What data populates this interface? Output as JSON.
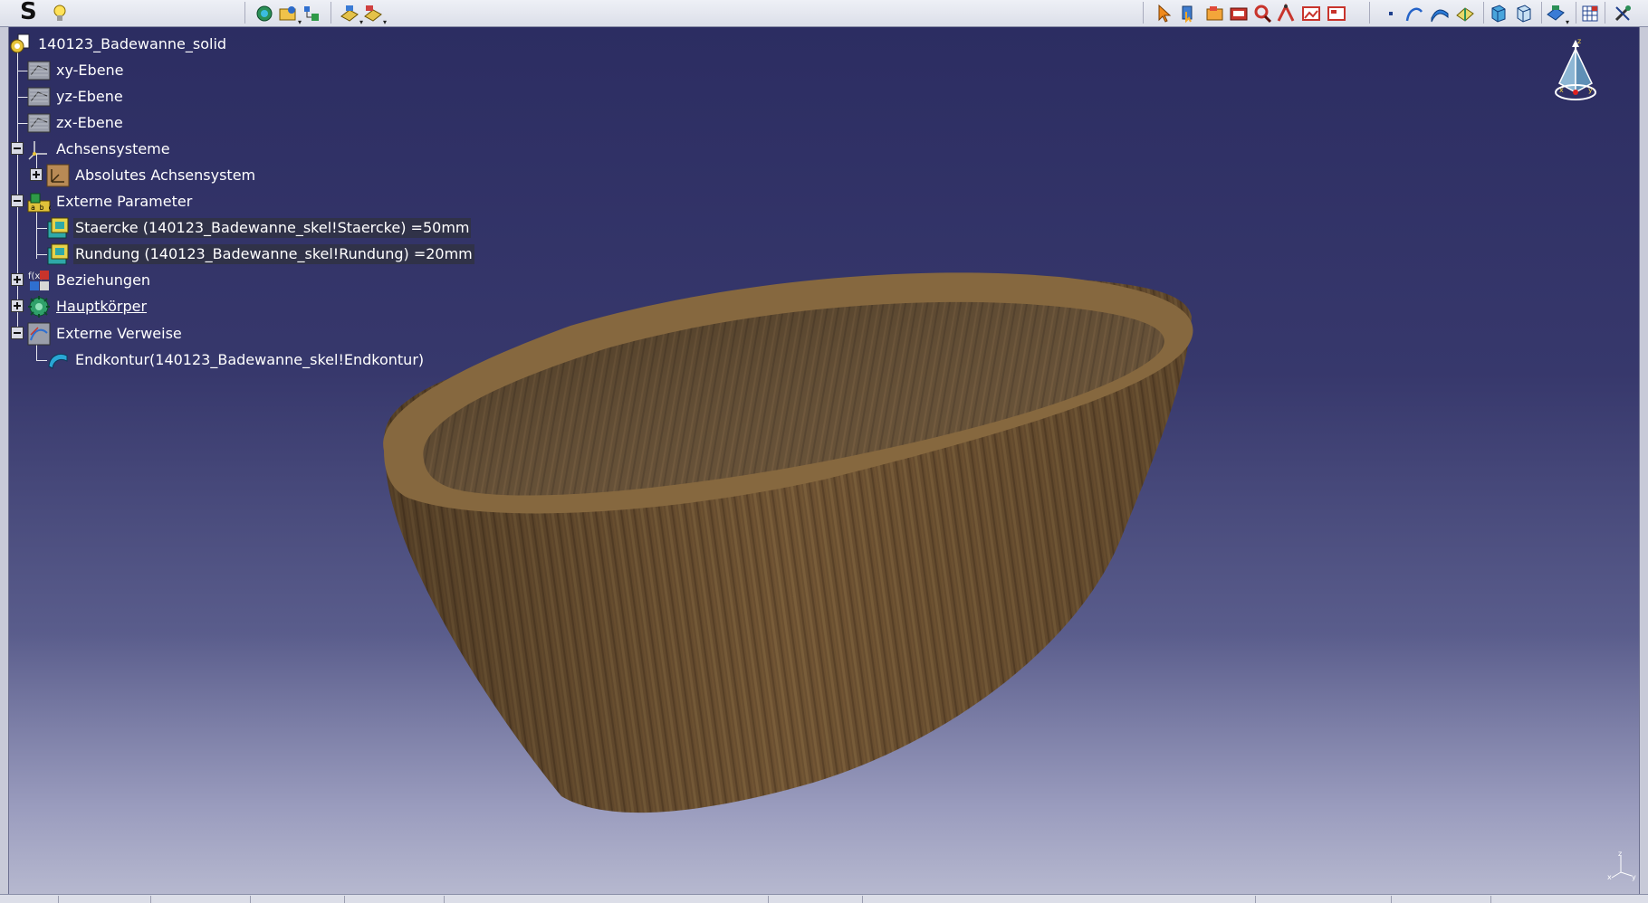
{
  "app": {
    "logo_letter": "S"
  },
  "toolbar": {
    "left_icons": [
      "bulb-icon",
      "globe-network-icon",
      "folder-gear-icon",
      "tree-settings-icon",
      "part-drop-icon",
      "part-drop-2-icon"
    ],
    "right_icons": [
      "select-arrow-icon",
      "hand-pointer-icon",
      "open-folder-icon",
      "folder-red-icon",
      "search-red-icon",
      "measure-icon",
      "image-red-icon",
      "image-red-2-icon",
      "point-icon",
      "curve-icon",
      "surface-icon",
      "measure-book-icon",
      "cube-view-icon",
      "cube-view-2-icon",
      "render-settings-icon",
      "grid-icon",
      "tools-icon"
    ]
  },
  "tree": {
    "root": {
      "label": "140123_Badewanne_solid",
      "icon": "part-root-icon"
    },
    "items": [
      {
        "id": "xy-plane",
        "label": "xy-Ebene",
        "icon": "plane-icon",
        "level": 1
      },
      {
        "id": "yz-plane",
        "label": "yz-Ebene",
        "icon": "plane-icon",
        "level": 1
      },
      {
        "id": "zx-plane",
        "label": "zx-Ebene",
        "icon": "plane-icon",
        "level": 1
      },
      {
        "id": "axis-systems",
        "label": "Achsensysteme",
        "icon": "axis-system-icon",
        "level": 1,
        "expander": "minus"
      },
      {
        "id": "absolute-axis",
        "label": "Absolutes Achsensystem",
        "icon": "axis-frame-icon",
        "level": 2,
        "expander": "plus"
      },
      {
        "id": "external-params",
        "label": "Externe Parameter",
        "icon": "parameters-icon",
        "level": 1,
        "expander": "minus"
      },
      {
        "id": "param-thickness",
        "label": "Staercke (140123_Badewanne_skel!Staercke) =50mm",
        "icon": "parameter-value-icon",
        "level": 2
      },
      {
        "id": "param-rounding",
        "label": "Rundung (140123_Badewanne_skel!Rundung) =20mm",
        "icon": "parameter-value-icon",
        "level": 2
      },
      {
        "id": "relations",
        "label": "Beziehungen",
        "icon": "relations-icon",
        "level": 1,
        "expander": "plus"
      },
      {
        "id": "main-body",
        "label": "Hauptkörper",
        "icon": "body-gear-icon",
        "level": 1,
        "expander": "plus",
        "underline": true
      },
      {
        "id": "external-refs",
        "label": "Externe Verweise",
        "icon": "external-refs-icon",
        "level": 1,
        "expander": "minus"
      },
      {
        "id": "end-contour",
        "label": "Endkontur(140123_Badewanne_skel!Endkontur)",
        "icon": "surface-feature-icon",
        "level": 2
      }
    ]
  },
  "viewport": {
    "model": "bathtub-solid",
    "model_color": "#6e5434",
    "background_top": "#2c2d62",
    "background_bottom": "#b6b8cf"
  },
  "compass": {
    "labels": [
      "z",
      "x",
      "y"
    ]
  },
  "mini_axis": {
    "labels": [
      "z",
      "x",
      "y"
    ]
  }
}
